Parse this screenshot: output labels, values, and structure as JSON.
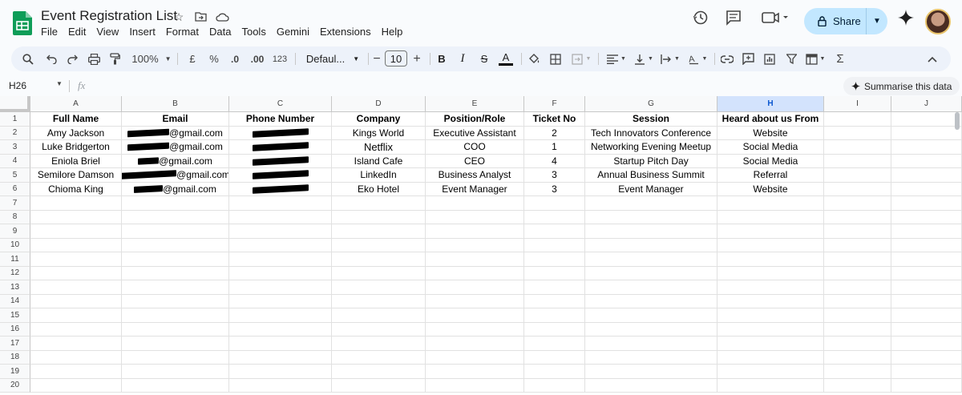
{
  "app": {
    "title": "Event Registration List",
    "menu": [
      "File",
      "Edit",
      "View",
      "Insert",
      "Format",
      "Data",
      "Tools",
      "Gemini",
      "Extensions",
      "Help"
    ],
    "share_label": "Share"
  },
  "toolbar": {
    "zoom": "100%",
    "currency": "£",
    "percent": "%",
    "dec_dec": ".0",
    "dec_inc": ".00",
    "number_format": "123",
    "font": "Defaul...",
    "font_size": "10"
  },
  "formula_bar": {
    "cell_ref": "H26",
    "fx": "fx"
  },
  "summarise_label": "Summarise this data",
  "columns": [
    "A",
    "B",
    "C",
    "D",
    "E",
    "F",
    "G",
    "H",
    "I",
    "J"
  ],
  "rows": [
    "1",
    "2",
    "3",
    "4",
    "5",
    "6",
    "7",
    "8",
    "9",
    "10",
    "11",
    "12",
    "13",
    "14",
    "15",
    "16",
    "17",
    "18",
    "19",
    "20"
  ],
  "sheet": {
    "headers": [
      "Full Name",
      "Email",
      "Phone Number",
      "Company",
      "Position/Role",
      "Ticket No",
      "Session",
      "Heard about us From"
    ],
    "records": [
      {
        "name": "Amy Jackson",
        "email": "@gmail.com",
        "company": "Kings World",
        "role": "Executive Assistant",
        "ticket": "2",
        "session": "Tech Innovators Conference",
        "heard": "Website"
      },
      {
        "name": "Luke Bridgerton",
        "email": "@gmail.com",
        "company": "Netflix",
        "role": "COO",
        "ticket": "1",
        "session": "Networking Evening Meetup",
        "heard": "Social Media"
      },
      {
        "name": "Eniola Briel",
        "email": "@gmail.com",
        "company": "Island Cafe",
        "role": "CEO",
        "ticket": "4",
        "session": "Startup Pitch Day",
        "heard": "Social Media"
      },
      {
        "name": "Semilore Damson",
        "email": "@gmail.com",
        "company": "LinkedIn",
        "role": "Business Analyst",
        "ticket": "3",
        "session": "Annual Business Summit",
        "heard": "Referral"
      },
      {
        "name": "Chioma King",
        "email": "@gmail.com",
        "company": "Eko Hotel",
        "role": "Event Manager",
        "ticket": "3",
        "session": "Event Manager",
        "heard": "Website"
      }
    ]
  },
  "selected_column": "H",
  "colors": {
    "accent": "#0b57d0",
    "share_bg": "#c2e7ff",
    "sheets_green": "#0f9d58"
  }
}
